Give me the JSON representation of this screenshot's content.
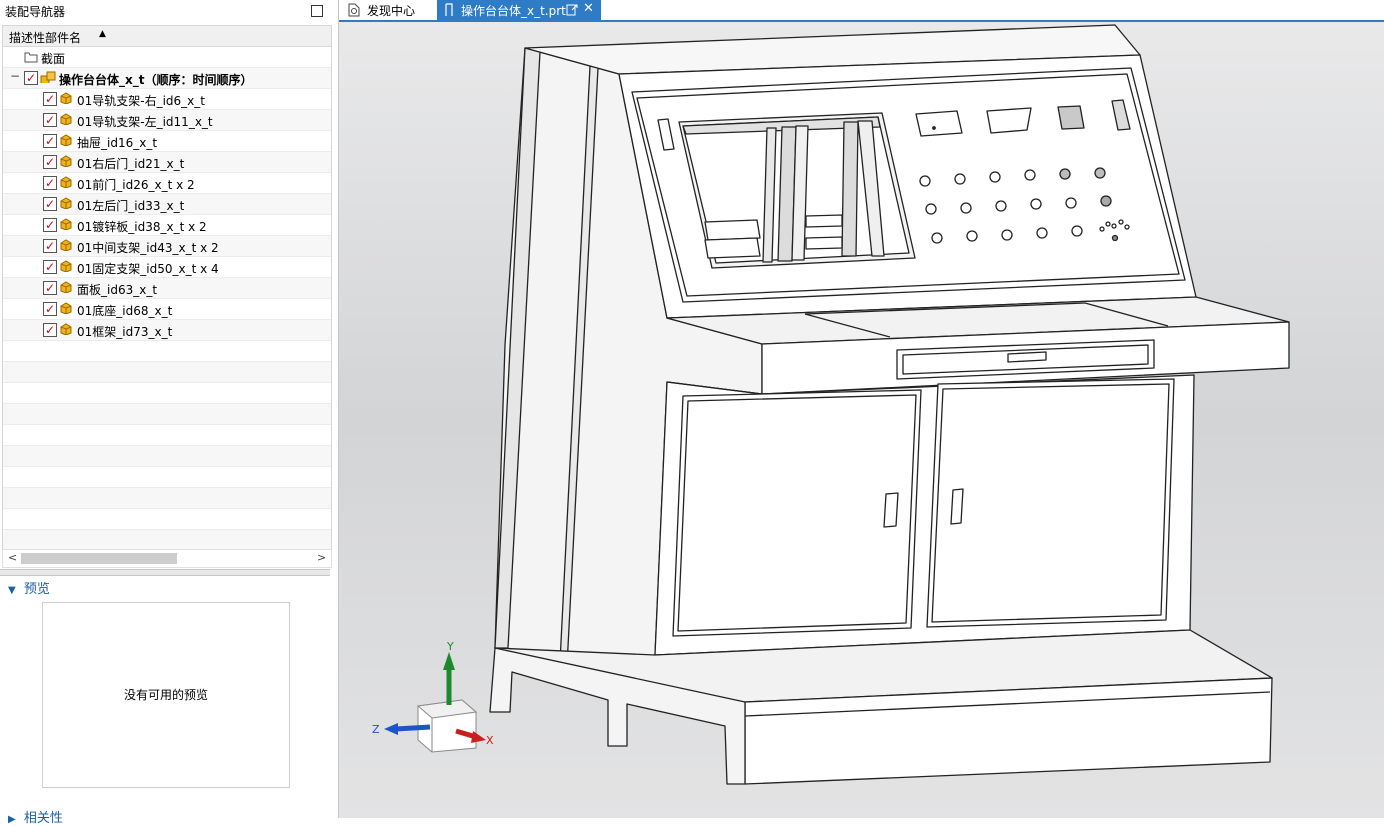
{
  "panel": {
    "title": "装配导航器",
    "column_header": "描述性部件名",
    "root_item": "截面",
    "assembly": "操作台台体_x_t（顺序：时间顺序）",
    "items": [
      "01导轨支架-右_id6_x_t",
      "01导轨支架-左_id11_x_t",
      "抽屉_id16_x_t",
      "01右后门_id21_x_t",
      "01前门_id26_x_t x 2",
      "01左后门_id33_x_t",
      "01镀锌板_id38_x_t x 2",
      "01中间支架_id43_x_t x 2",
      "01固定支架_id50_x_t x 4",
      "面板_id63_x_t",
      "01底座_id68_x_t",
      "01框架_id73_x_t"
    ]
  },
  "preview": {
    "title": "预览",
    "empty_text": "没有可用的预览"
  },
  "related": {
    "title": "相关性"
  },
  "tabs": [
    {
      "label": "发现中心"
    },
    {
      "label": "操作台台体_x_t.prt"
    }
  ],
  "triad": {
    "x": "X",
    "y": "Y",
    "z": "Z"
  },
  "colors": {
    "accent": "#2e7bc6",
    "check": "#d0021b",
    "cube": "#f2b21a"
  }
}
